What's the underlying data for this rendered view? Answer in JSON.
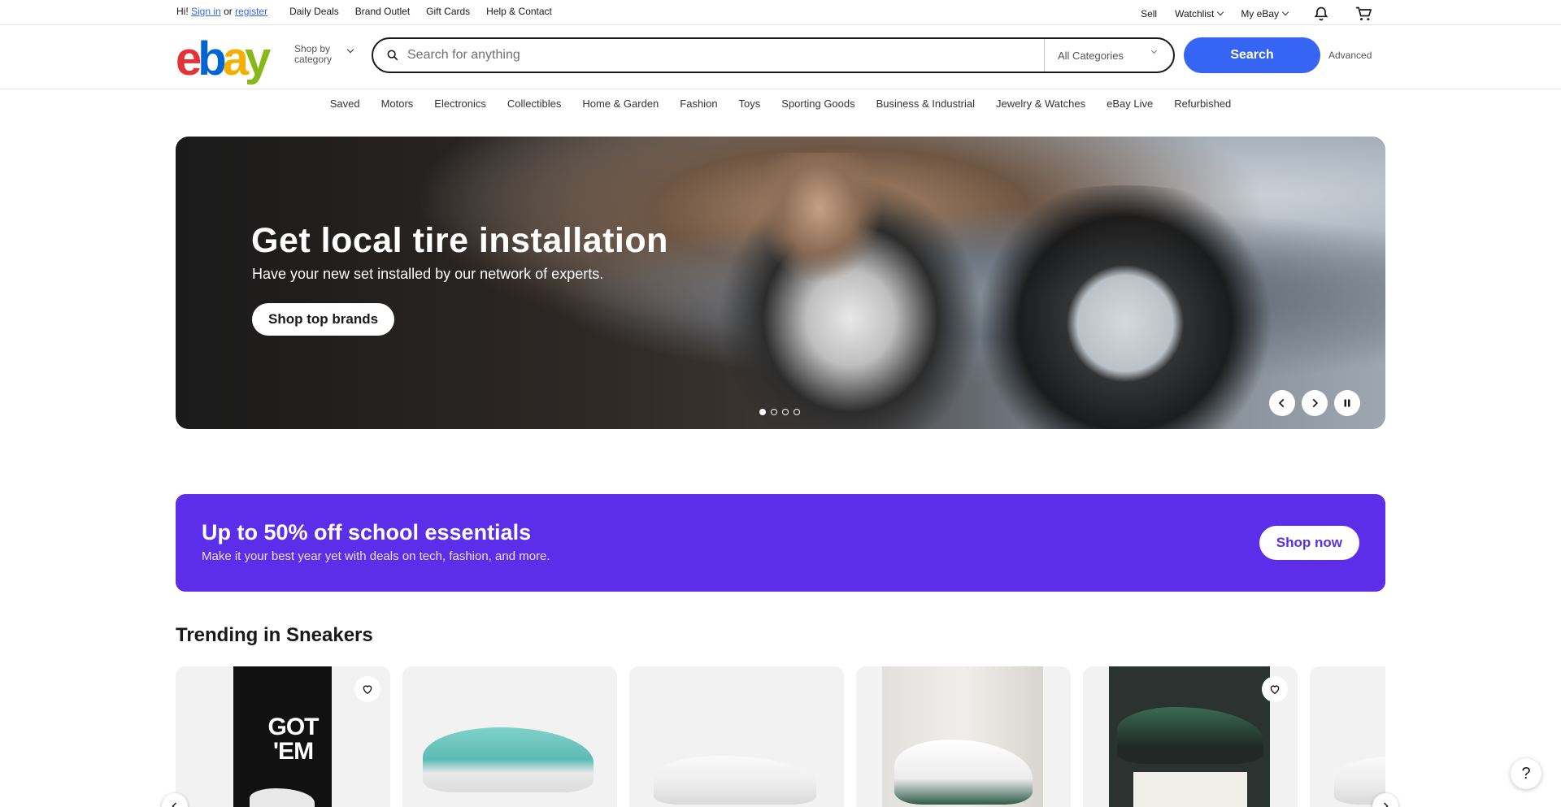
{
  "topbar": {
    "greeting_prefix": "Hi!",
    "sign_in": "Sign in",
    "or": "or",
    "register": "register",
    "left_links": [
      "Daily Deals",
      "Brand Outlet",
      "Gift Cards",
      "Help & Contact"
    ],
    "sell": "Sell",
    "watchlist": "Watchlist",
    "my_ebay": "My eBay"
  },
  "header": {
    "logo": {
      "e": "e",
      "b": "b",
      "a": "a",
      "y": "y"
    },
    "shop_by_line1": "Shop by",
    "shop_by_line2": "category",
    "search_placeholder": "Search for anything",
    "category_select": "All Categories",
    "search_button": "Search",
    "advanced": "Advanced"
  },
  "categories": [
    "Saved",
    "Motors",
    "Electronics",
    "Collectibles",
    "Home & Garden",
    "Fashion",
    "Toys",
    "Sporting Goods",
    "Business & Industrial",
    "Jewelry & Watches",
    "eBay Live",
    "Refurbished"
  ],
  "hero": {
    "title": "Get local tire installation",
    "subtitle": "Have your new set installed by our network of experts.",
    "cta": "Shop top brands",
    "slides_total": 4,
    "active_slide": 1
  },
  "promo": {
    "title": "Up to 50% off school essentials",
    "subtitle": "Make it your best year yet with deals on tech, fashion, and more.",
    "cta": "Shop now",
    "bg_color": "#5c2eea"
  },
  "trending": {
    "title": "Trending in Sneakers",
    "cards": [
      {
        "image": "got-em-sneaker-image",
        "got_em_text": "GOT 'EM",
        "favorite": true
      },
      {
        "image": "teal-dunk-low-image",
        "favorite": false
      },
      {
        "image": "white-sneaker-image",
        "favorite": false
      },
      {
        "image": "jordan-4-oxidized-green-image",
        "favorite": false
      },
      {
        "image": "green-dunk-box-image",
        "favorite": true
      },
      {
        "image": "white-sneaker-image-2",
        "favorite": false
      }
    ]
  },
  "help": "?",
  "colors": {
    "accent": "#3665f3",
    "promo": "#5c2eea"
  }
}
